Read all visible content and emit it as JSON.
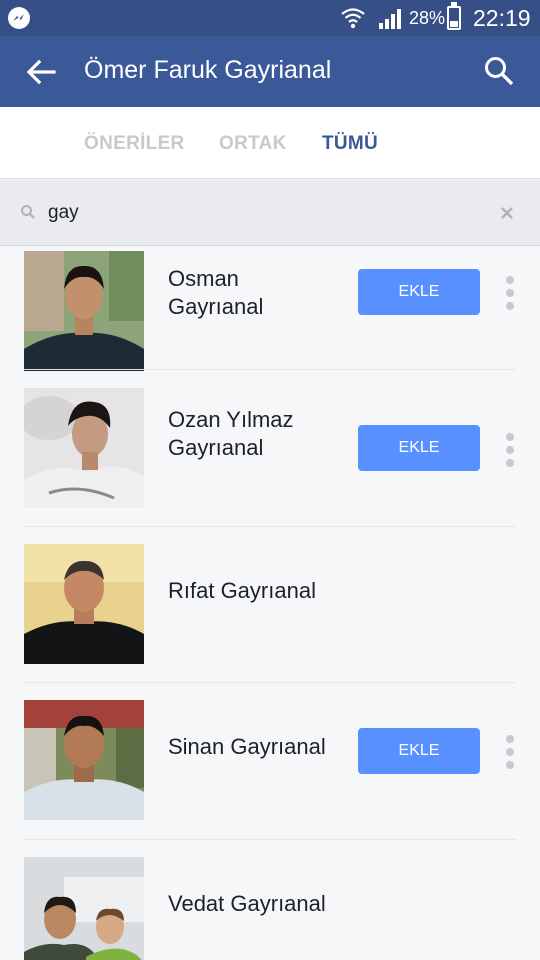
{
  "status_bar": {
    "battery": "28%",
    "time": "22:19",
    "icons": [
      "messenger-icon",
      "wifi-icon",
      "signal-icon",
      "battery-icon"
    ]
  },
  "header": {
    "title": "Ömer Faruk Gayrianal",
    "icons": [
      "back-arrow-icon",
      "search-icon"
    ]
  },
  "tabs": [
    {
      "label": "ÖNERİLER",
      "active": false
    },
    {
      "label": "ORTAK",
      "active": false
    },
    {
      "label": "TÜMÜ",
      "active": true
    }
  ],
  "filter": {
    "value": "gay",
    "icons": [
      "search-icon",
      "clear-icon"
    ]
  },
  "add_label": "EKLE",
  "friends": [
    {
      "name_lines": [
        "Osman",
        "Gayrıanal"
      ],
      "has_add": true
    },
    {
      "name_lines": [
        "Ozan Yılmaz",
        "Gayrıanal"
      ],
      "has_add": true
    },
    {
      "name_lines": [
        "Rıfat Gayrıanal"
      ],
      "has_add": false
    },
    {
      "name_lines": [
        "Sinan Gayrıanal"
      ],
      "has_add": true
    },
    {
      "name_lines": [
        "Vedat Gayrıanal"
      ],
      "has_add": false
    }
  ],
  "colors": {
    "status_bar": "#364f87",
    "app_bar": "#3b5998",
    "tab_active": "#3b5998",
    "tab_inactive": "#c6c9ce",
    "add_button": "#5890ff",
    "filter_bg": "#e9ebee"
  }
}
